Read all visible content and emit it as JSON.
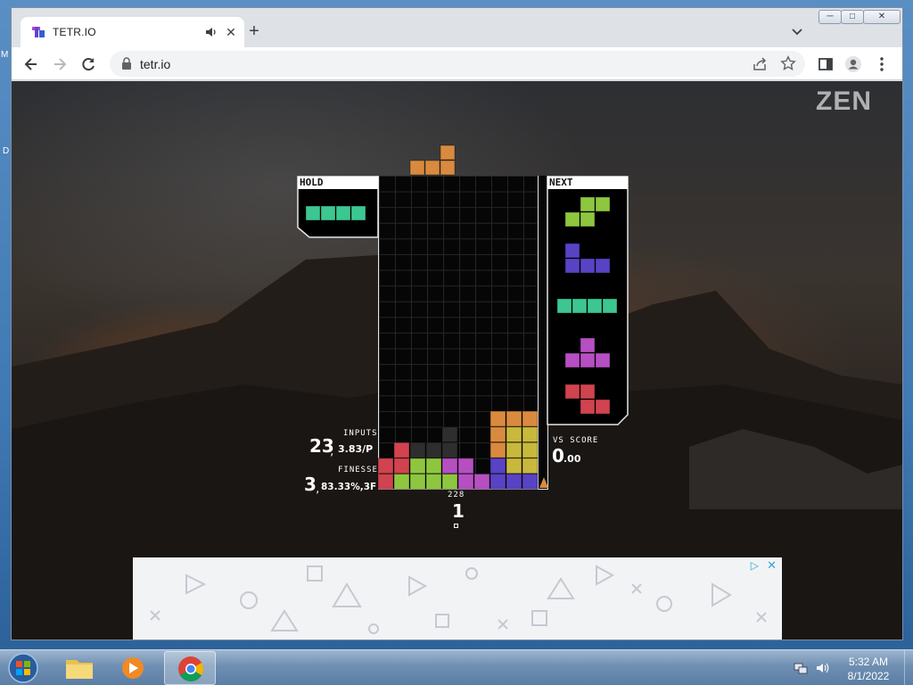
{
  "browser": {
    "tab_title": "TETR.IO",
    "url": "tetr.io",
    "window_controls": {
      "minimize": "─",
      "maximize": "□",
      "close": "✕"
    }
  },
  "game": {
    "mode_label": "ZEN",
    "hold_label": "HOLD",
    "next_label": "NEXT",
    "inputs_label": "INPUTS",
    "inputs_value": "23",
    "inputs_rate": "3.83/P",
    "finesse_label": "FINESSE",
    "finesse_value": "3",
    "finesse_detail": "83.33%,3F",
    "vs_score_label": "VS SCORE",
    "vs_score_int": "0",
    "vs_score_dec": ".00",
    "level_small": "228",
    "level_big": "1",
    "colors": {
      "I": "#3cc791",
      "O": "#c8b83c",
      "T": "#b64fc2",
      "S": "#8fc640",
      "Z": "#d0434f",
      "J": "#5843c4",
      "L": "#d98a3e",
      "garbage": "#2e2e2e"
    },
    "hold_piece": "I",
    "next_queue": [
      "S",
      "J",
      "I",
      "T",
      "Z"
    ],
    "active_piece": "L"
  },
  "taskbar": {
    "clock_time": "5:32 AM",
    "clock_date": "8/1/2022",
    "items": [
      "Windows Explorer",
      "Windows Media Player",
      "Google Chrome"
    ]
  },
  "desktop_edge": {
    "label_1": "M",
    "label_2": "D"
  }
}
